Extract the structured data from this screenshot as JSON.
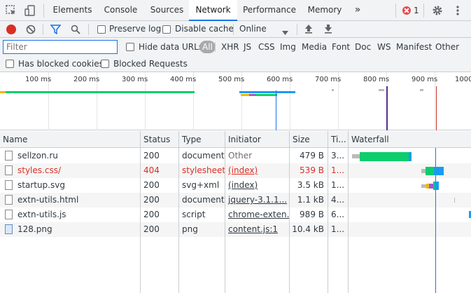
{
  "tabs": [
    {
      "label": "Elements",
      "active": false
    },
    {
      "label": "Console",
      "active": false
    },
    {
      "label": "Sources",
      "active": false
    },
    {
      "label": "Network",
      "active": true
    },
    {
      "label": "Performance",
      "active": false
    },
    {
      "label": "Memory",
      "active": false
    }
  ],
  "more_tabs_glyph": "»",
  "error_count": "1",
  "toolbar": {
    "preserve_log": "Preserve log",
    "disable_cache": "Disable cache",
    "throttling": "Online"
  },
  "filter": {
    "placeholder": "Filter",
    "hide_data_urls": "Hide data URLs",
    "types": [
      "All",
      "XHR",
      "JS",
      "CSS",
      "Img",
      "Media",
      "Font",
      "Doc",
      "WS",
      "Manifest",
      "Other"
    ],
    "has_blocked_cookies": "Has blocked cookies",
    "blocked_requests": "Blocked Requests"
  },
  "overview": {
    "ticks": [
      "100 ms",
      "200 ms",
      "300 ms",
      "400 ms",
      "500 ms",
      "600 ms",
      "700 ms",
      "800 ms",
      "900 ms",
      "1000"
    ]
  },
  "columns": [
    "Name",
    "Status",
    "Type",
    "Initiator",
    "Size",
    "Ti...",
    "Waterfall"
  ],
  "rows": [
    {
      "name": "sellzon.ru",
      "status": "200",
      "type": "document",
      "initiator": "Other",
      "size": "479 B",
      "time": "3...",
      "error": false,
      "icon": "document-icon"
    },
    {
      "name": "styles.css/",
      "status": "404",
      "type": "stylesheet",
      "initiator": "(index)",
      "size": "539 B",
      "time": "1...",
      "error": true,
      "icon": "stylesheet-icon"
    },
    {
      "name": "startup.svg",
      "status": "200",
      "type": "svg+xml",
      "initiator": "(index)",
      "size": "3.5 kB",
      "time": "1...",
      "error": false,
      "icon": "svg-file-icon"
    },
    {
      "name": "extn-utils.html",
      "status": "200",
      "type": "document",
      "initiator": "jquery-3.1.1...",
      "size": "1.1 kB",
      "time": "4...",
      "error": false,
      "icon": "document-icon"
    },
    {
      "name": "extn-utils.js",
      "status": "200",
      "type": "script",
      "initiator": "chrome-exten...",
      "size": "989 B",
      "time": "6...",
      "error": false,
      "icon": "script-icon"
    },
    {
      "name": "128.png",
      "status": "200",
      "type": "png",
      "initiator": "content.js:1",
      "size": "10.4 kB",
      "time": "1...",
      "error": false,
      "icon": "image-icon"
    }
  ],
  "colors": {
    "record": "#d93025",
    "accent": "#1a73e8",
    "error_text": "#d93025",
    "waterfall_green": "#0cce6b",
    "waterfall_blue": "#1a9bf0",
    "waterfall_purple": "#9d5bd2",
    "waterfall_orange": "#f2b60f"
  }
}
